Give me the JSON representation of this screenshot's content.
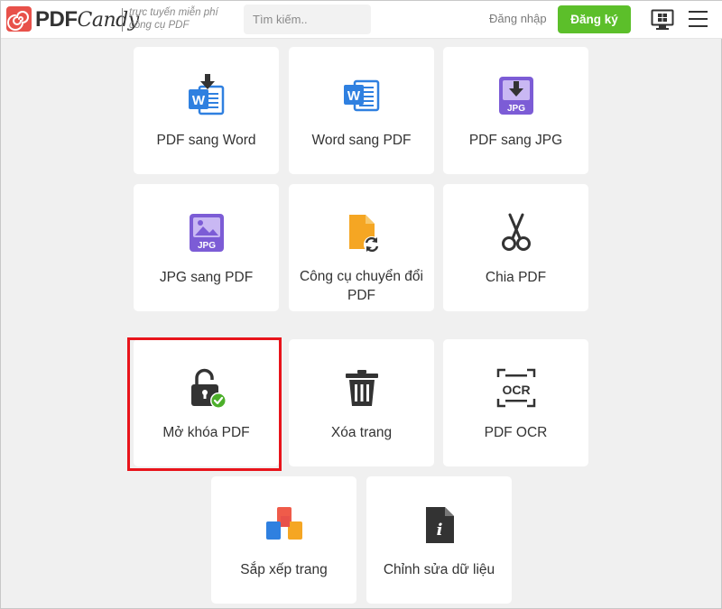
{
  "header": {
    "logo": {
      "text_bold": "PDF",
      "text_italic": "Candy"
    },
    "tagline": [
      "trực tuyến miễn phí",
      "công cụ PDF"
    ],
    "search": {
      "placeholder": "Tìm kiếm..",
      "value": ""
    },
    "login_label": "Đăng nhập",
    "signup_label": "Đăng ký"
  },
  "tools": [
    {
      "label": "PDF sang Word",
      "icon": "pdf-to-word-icon"
    },
    {
      "label": "Word sang PDF",
      "icon": "word-icon"
    },
    {
      "label": "PDF sang JPG",
      "icon": "pdf-to-jpg-icon"
    },
    {
      "label": "JPG sang PDF",
      "icon": "jpg-image-icon"
    },
    {
      "label": "Công cụ chuyển đổi PDF",
      "icon": "file-convert-icon"
    },
    {
      "label": "Chia PDF",
      "icon": "scissors-icon"
    },
    {
      "label": "Mở khóa PDF",
      "icon": "unlock-icon"
    },
    {
      "label": "Xóa trang",
      "icon": "trash-icon"
    },
    {
      "label": "PDF OCR",
      "icon": "ocr-icon"
    },
    {
      "label": "Sắp xếp trang",
      "icon": "rearrange-pages-icon"
    },
    {
      "label": "Chỉnh sửa dữ liệu",
      "icon": "edit-metadata-icon"
    }
  ],
  "highlighted_tool": "Mở khóa PDF",
  "colors": {
    "brand_red": "#e8514a",
    "signup_green": "#5cbf2a",
    "word_blue": "#2f80e0",
    "jpg_purple": "#7c5cd6",
    "highlight_red": "#e8141b"
  }
}
